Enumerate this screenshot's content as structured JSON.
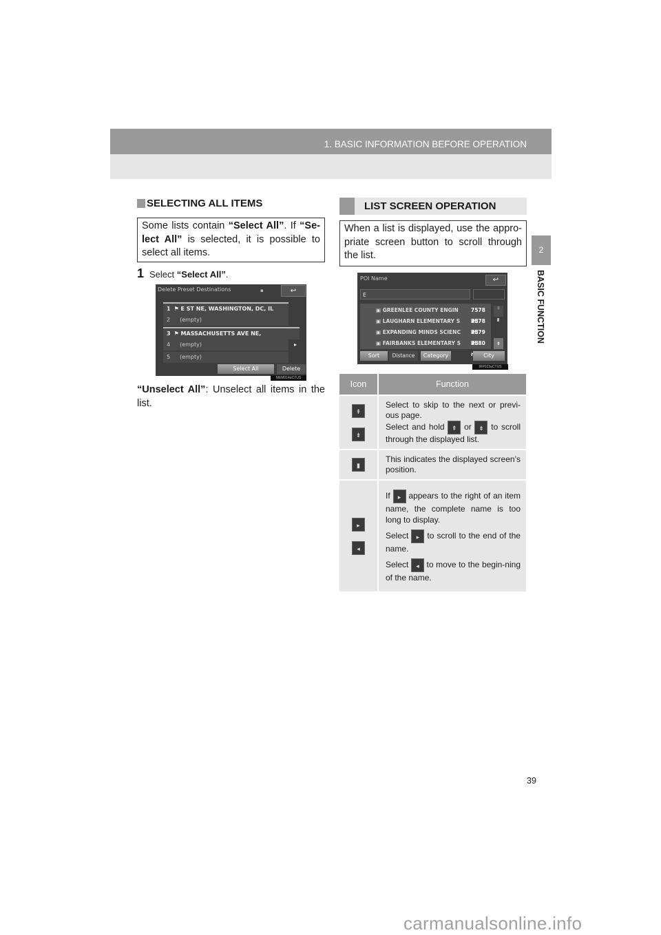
{
  "header": {
    "section_title": "1. BASIC INFORMATION BEFORE OPERATION"
  },
  "chapter": {
    "number": "2",
    "label": "BASIC FUNCTION"
  },
  "selecting_all": {
    "heading": "SELECTING ALL ITEMS",
    "note_parts": [
      "Some lists contain ",
      "“Select All”",
      ". If ",
      "“Se-lect All”",
      " is selected, it is possible to select all items."
    ],
    "step_number": "1",
    "step_text_prefix": "Select ",
    "step_text_bold": "“Select All”",
    "step_text_suffix": ".",
    "unselect_term": "“Unselect All”",
    "unselect_desc": ": Unselect all items in the list."
  },
  "screen1": {
    "title": "Delete Preset Destinations",
    "back_icon": "back-arrow-icon",
    "rows": [
      {
        "num": "1",
        "text": "E ST NE, WASHINGTON, DC, IL",
        "flag": true
      },
      {
        "num": "2",
        "text": "(empty)",
        "flag": false
      },
      {
        "num": "3",
        "text": "MASSACHUSETTS AVE NE, WASHINGTON,",
        "flag": true
      },
      {
        "num": "4",
        "text": "(empty)",
        "flag": false
      },
      {
        "num": "5",
        "text": "(empty)",
        "flag": false
      }
    ],
    "select_all_label": "Select All",
    "delete_label": "Delete",
    "caption": "MEM014aCTUS"
  },
  "list_op": {
    "heading": "LIST SCREEN OPERATION",
    "note": "When a list is displayed, use the appro-priate screen button to scroll through the list."
  },
  "screen2": {
    "title": "POI Name",
    "input_value": "E",
    "rows": [
      {
        "name": "GREENLEE COUNTY ENGIN",
        "distance": "7578 mi"
      },
      {
        "name": "LAUGHARN ELEMENTARY S",
        "distance": "7578 mi"
      },
      {
        "name": "EXPANDING MINDS SCIENC",
        "distance": "7579 mi"
      },
      {
        "name": "FAIRBANKS ELEMENTARY S",
        "distance": "7580 mi"
      }
    ],
    "sort_label": "Sort",
    "distance_label": "Distance",
    "category_label": "Category",
    "city_label": "City",
    "caption": "IRP023aCTUS"
  },
  "icon_table": {
    "headers": [
      "Icon",
      "Function"
    ],
    "rows": [
      {
        "icons": [
          "page-up-icon",
          "page-down-icon"
        ],
        "text": [
          "Select to skip to the next or previ-ous page.",
          "Select and hold",
          "or",
          "to scroll through the displayed list."
        ]
      },
      {
        "icons": [
          "scroll-position-icon"
        ],
        "text": [
          "This indicates the displayed screen’s position."
        ]
      },
      {
        "icons": [
          "expand-name-icon",
          "back-to-start-icon"
        ],
        "text": [
          "If",
          "appears to the right of an item name, the complete name is too long to display.",
          "Select",
          "to scroll to the end of the name.",
          "Select",
          "to move to the begin-ning of the name."
        ]
      }
    ]
  },
  "page_number": "39",
  "watermark": "carmanualsonline.info"
}
